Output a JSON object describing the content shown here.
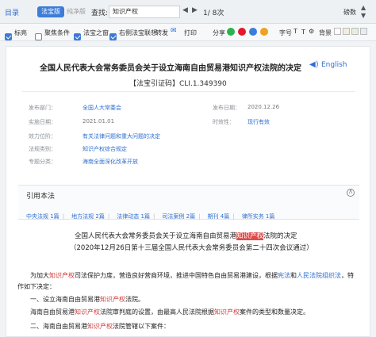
{
  "toolbar": {
    "toc": "目录",
    "tab_fabao": "法宝版",
    "tab_pure": "纯净版",
    "search_label": "查找:",
    "search_value": "知识产权",
    "match_info": "1/ 8次",
    "font_label": "磅数",
    "checks": [
      {
        "label": "标亮",
        "checked": true
      },
      {
        "label": "聚焦条件",
        "checked": false
      },
      {
        "label": "法宝之窗",
        "checked": true
      },
      {
        "label": "右侧法宝联想",
        "checked": true
      }
    ],
    "actions": [
      "转发",
      "打印",
      "分享",
      "字号",
      "背景"
    ]
  },
  "doc": {
    "title": "全国人民代表大会常务委员会关于设立海南自由贸易港知识产权法院的决定",
    "english": "English",
    "cite": "【法宝引证码】CLI.1.349390",
    "meta": {
      "issuer_label": "发布部门：",
      "issuer": "全国人大常委会",
      "issue_date_label": "发布日期：",
      "issue_date": "2020.12.26",
      "effective_label": "实施日期：",
      "effective_date": "2021.01.01",
      "status_label": "时效性：",
      "status": "现行有效",
      "level_label": "效力位阶：",
      "level": "有关法律问题和重大问题的决定",
      "category_label": "法规类别：",
      "category": "知识产权综合规定",
      "topic_label": "专题分类：",
      "topic": "海南全面深化改革开放"
    },
    "references": {
      "heading": "引用本法",
      "links": [
        "中央法规 1篇",
        "地方法规 2篇",
        "法律动态 1篇",
        "司法案例 2篇",
        "期刊 4篇",
        "律所实务 1篇"
      ]
    },
    "body": {
      "heading_pre": "全国人民代表大会常务委员会关于设立海南自由贸易港",
      "heading_hl": "知识产权",
      "heading_post": "法院的决定",
      "subheading": "（2020年12月26日第十三届全国人民代表大会常务委员会第二十四次会议通过）",
      "p1_a": "为加大",
      "p1_hl": "知识产权",
      "p1_b": "司法保护力度，营造良好营商环境，推进中国特色自由贸易港建设，根据",
      "p1_link1": "宪法",
      "p1_and": "和",
      "p1_link2": "人民法院组织法",
      "p1_c": "，特",
      "p1_d": "作如下决定：",
      "item1_a": "一、设立海南自由贸易港",
      "item1_hl": "知识产权",
      "item1_b": "法院。",
      "p2_a": "海南自由贸易港",
      "p2_hl1": "知识产权",
      "p2_b": "法院审判庭的设置，由最高人民法院根据",
      "p2_hl2": "知识产权",
      "p2_c": "案件的类型和数量决定。",
      "item2_a": "二、海南自由贸易港",
      "item2_hl": "知识产权",
      "item2_b": "法院管辖以下案件："
    }
  }
}
